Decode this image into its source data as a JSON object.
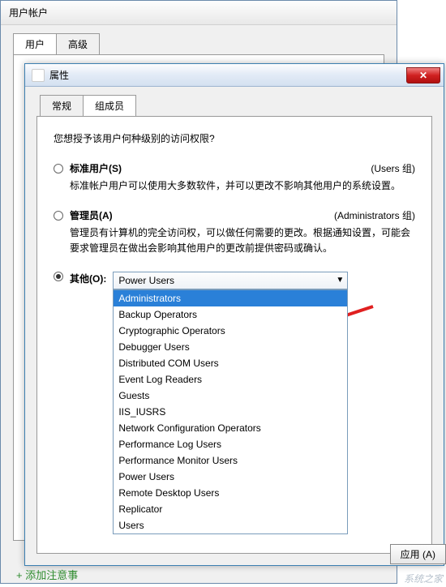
{
  "outer": {
    "title": "用户帐户",
    "tabs": [
      "用户",
      "高级"
    ]
  },
  "inner": {
    "title_suffix": "属性",
    "tabs": [
      "常规",
      "组成员"
    ],
    "active_tab": 1,
    "close_glyph": "✕"
  },
  "panel": {
    "question": "您想授予该用户何种级别的访问权限?",
    "options": [
      {
        "label": "标准用户(S)",
        "group_hint": "(Users 组)",
        "desc": "标准帐户用户可以使用大多数软件，并可以更改不影响其他用户的系统设置。"
      },
      {
        "label": "管理员(A)",
        "group_hint": "(Administrators 组)",
        "desc": "管理员有计算机的完全访问权，可以做任何需要的更改。根据通知设置，可能会要求管理员在做出会影响其他用户的更改前提供密码或确认。"
      },
      {
        "label": "其他(O):",
        "group_hint": ""
      }
    ],
    "combo_selected": "Power Users",
    "dropdown_items": [
      "Administrators",
      "Backup Operators",
      "Cryptographic Operators",
      "Debugger Users",
      "Distributed COM Users",
      "Event Log Readers",
      "Guests",
      "IIS_IUSRS",
      "Network Configuration Operators",
      "Performance Log Users",
      "Performance Monitor Users",
      "Power Users",
      "Remote Desktop Users",
      "Replicator",
      "Users"
    ],
    "highlight_index": 0
  },
  "buttons": {
    "apply": "应用 (A)"
  },
  "footer": {
    "add_note": "+ 添加注意事",
    "watermark": "系统之家"
  }
}
